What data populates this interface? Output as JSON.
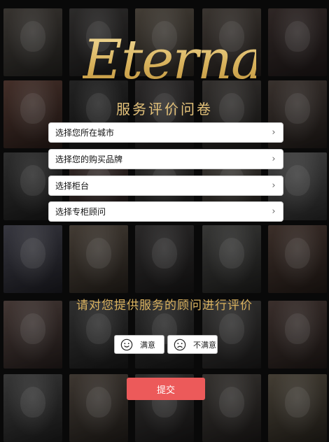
{
  "brand": {
    "logo_text": "Eternal"
  },
  "page": {
    "subtitle": "服务评价问卷"
  },
  "selects": [
    {
      "label": "选择您所在城市"
    },
    {
      "label": "选择您的购买品牌"
    },
    {
      "label": "选择柜台"
    },
    {
      "label": "选择专柜顾问"
    }
  ],
  "rating": {
    "prompt": "请对您提供服务的顾问进行评价",
    "satisfied_label": "满意",
    "unsatisfied_label": "不满意",
    "satisfied_icon": "smile-icon",
    "unsatisfied_icon": "frown-icon"
  },
  "actions": {
    "submit_label": "提交"
  },
  "colors": {
    "gold": "#e4c27a",
    "submit": "#ec5a5a",
    "background": "#0d0d0d"
  }
}
